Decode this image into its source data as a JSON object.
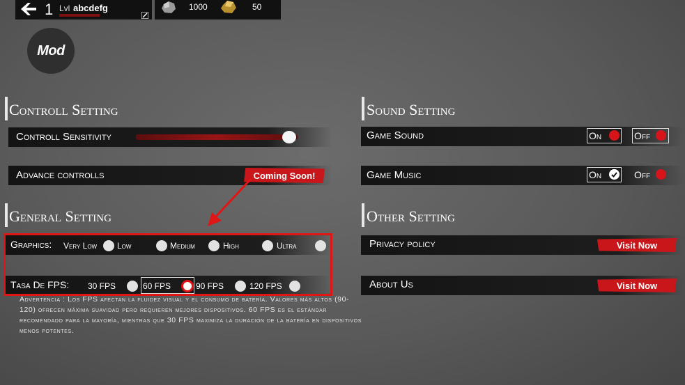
{
  "header": {
    "level": "1",
    "level_prefix": "Lvl",
    "username": "abcdefg",
    "stone_count": "1000",
    "gold_count": "50"
  },
  "badge": {
    "label": "Mod"
  },
  "controll": {
    "title": "Controll Setting",
    "sensitivity_label": "Controll Sensitivity",
    "sensitivity_value": 0.95,
    "advance_label": "Advance controlls",
    "coming_soon": "Coming Soon!"
  },
  "general": {
    "title": "General Setting",
    "graphics_label": "Graphics:",
    "graphics_options": [
      "Very Low",
      "Low",
      "Medium",
      "High",
      "Ultra"
    ],
    "fps_label": "Tasa De FPS:",
    "fps_options": [
      "30 FPS",
      "60 FPS",
      "90 FPS",
      "120 FPS"
    ],
    "fps_selected": "60 FPS",
    "warning": "Advertencia : Los FPS afectan la fluidez visual y el consumo de batería. Valores más altos (90-120) ofrecen máxima suavidad pero requieren mejores dispositivos. 60 FPS es el estándar recomendado para la mayoría, mientras que 30 FPS maximiza la duración de la batería en dispositivos menos potentes."
  },
  "sound": {
    "title": "Sound Setting",
    "game_sound_label": "Game Sound",
    "game_music_label": "Game Music",
    "on_label": "On",
    "off_label": "Off"
  },
  "other": {
    "title": "Other Setting",
    "privacy_label": "Privacy policy",
    "about_label": "About Us",
    "visit_label": "Visit Now"
  },
  "colors": {
    "accent": "#c8161a",
    "highlight": "#e01515"
  }
}
